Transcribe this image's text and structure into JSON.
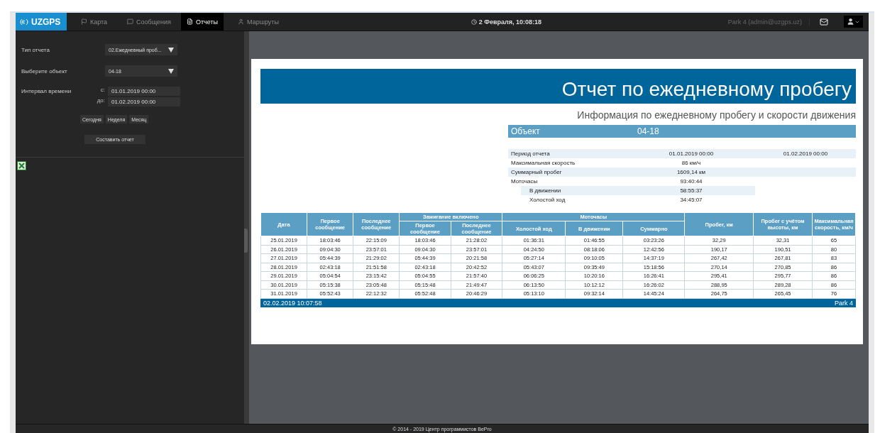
{
  "topbar": {
    "logo": "UZGPS",
    "tabs": [
      {
        "kind": "map",
        "label": "Карта",
        "selected": false
      },
      {
        "kind": "messages",
        "label": "Сообщения",
        "selected": false
      },
      {
        "kind": "reports",
        "label": "Отчеты",
        "selected": true
      },
      {
        "kind": "routes",
        "label": "Маршруты",
        "selected": false
      }
    ],
    "clock": "2 Февраля, 10:08:18",
    "user": "Park 4 (admin@uzgps.uz)"
  },
  "sidebar": {
    "report_type": {
      "label": "Тип отчета",
      "value": "02.Ежедневный проб..."
    },
    "object": {
      "label": "Выберите объект",
      "value": "04-18"
    },
    "interval": {
      "label": "Интервал времени",
      "from_label": "с:",
      "from": "01.01.2019 00:00",
      "to_label": "до:",
      "to": "01.02.2019 00:00"
    },
    "quick_buttons": [
      "Сегодня",
      "Неделя",
      "Месяц"
    ],
    "submit": "Составить отчет"
  },
  "report": {
    "title": "Отчет по ежедневному пробегу",
    "subtitle": "Информация по ежедневному пробегу и скорости движения",
    "object": {
      "label": "Объект",
      "value": "04-18"
    },
    "summary": [
      {
        "label": "Период отчета",
        "values": [
          "01.01.2019 00:00",
          "01.02.2019 00:00"
        ]
      },
      {
        "label": "Максимальная скорость",
        "values": [
          "86 км/ч"
        ]
      },
      {
        "label": "Суммарный пробег",
        "values": [
          "1609,14 км"
        ]
      },
      {
        "label": "Моточасы",
        "values": [
          "93:40:44"
        ],
        "children": [
          {
            "label": "В движении",
            "values": [
              "58:55:37"
            ]
          },
          {
            "label": "Холостой ход",
            "values": [
              "34:45:07"
            ]
          }
        ]
      }
    ],
    "table": {
      "header_rows": [
        [
          {
            "label": "Дата",
            "rowspan": 2
          },
          {
            "label": "Первое сообщение",
            "rowspan": 2
          },
          {
            "label": "Последнее сообщение",
            "rowspan": 2
          },
          {
            "label": "Зажигание включено",
            "colspan": 2
          },
          {
            "label": "Моточасы",
            "colspan": 3
          },
          {
            "label": "Пробег, км",
            "rowspan": 2
          },
          {
            "label": "Пробег с учётом высоты, км",
            "rowspan": 2
          },
          {
            "label": "Максимальная скорость, км/ч",
            "rowspan": 2
          }
        ],
        [
          {
            "label": "Первое сообщение"
          },
          {
            "label": "Последнее сообщение"
          },
          {
            "label": "Холостой ход"
          },
          {
            "label": "В движении"
          },
          {
            "label": "Суммарно"
          }
        ]
      ],
      "rows": [
        [
          "25.01.2019",
          "18:03:46",
          "22:15:09",
          "18:03:46",
          "21:28:02",
          "01:36:31",
          "01:46:55",
          "03:23:26",
          "32,29",
          "32,31",
          "65"
        ],
        [
          "26.01.2019",
          "09:04:30",
          "23:57:01",
          "09:04:30",
          "23:57:01",
          "04:24:50",
          "08:18:06",
          "12:42:56",
          "190,17",
          "190,51",
          "80"
        ],
        [
          "27.01.2019",
          "05:44:39",
          "21:29:02",
          "05:44:39",
          "20:21:58",
          "05:27:14",
          "09:10:05",
          "14:37:19",
          "267,42",
          "267,81",
          "83"
        ],
        [
          "28.01.2019",
          "02:43:18",
          "21:51:58",
          "02:43:18",
          "20:42:52",
          "05:43:07",
          "09:35:49",
          "15:18:56",
          "270,14",
          "270,85",
          "86"
        ],
        [
          "29.01.2019",
          "05:04:54",
          "23:15:42",
          "05:04:55",
          "21:57:40",
          "06:06:25",
          "10:20:16",
          "16:26:41",
          "295,41",
          "295,77",
          "86"
        ],
        [
          "30.01.2019",
          "05:15:38",
          "23:05:48",
          "05:15:48",
          "21:49:47",
          "06:13:50",
          "10:12:12",
          "16:26:02",
          "288,95",
          "289,28",
          "86"
        ],
        [
          "31.01.2019",
          "05:52:43",
          "22:12:32",
          "05:52:48",
          "20:46:29",
          "05:13:10",
          "09:32:14",
          "14:45:24",
          "264,75",
          "265,45",
          "76"
        ]
      ]
    },
    "footer": {
      "generated": "02.02.2019 10:07:58",
      "account": "Park 4"
    }
  },
  "footer": "© 2014 - 2019 Центр программистов BePro"
}
